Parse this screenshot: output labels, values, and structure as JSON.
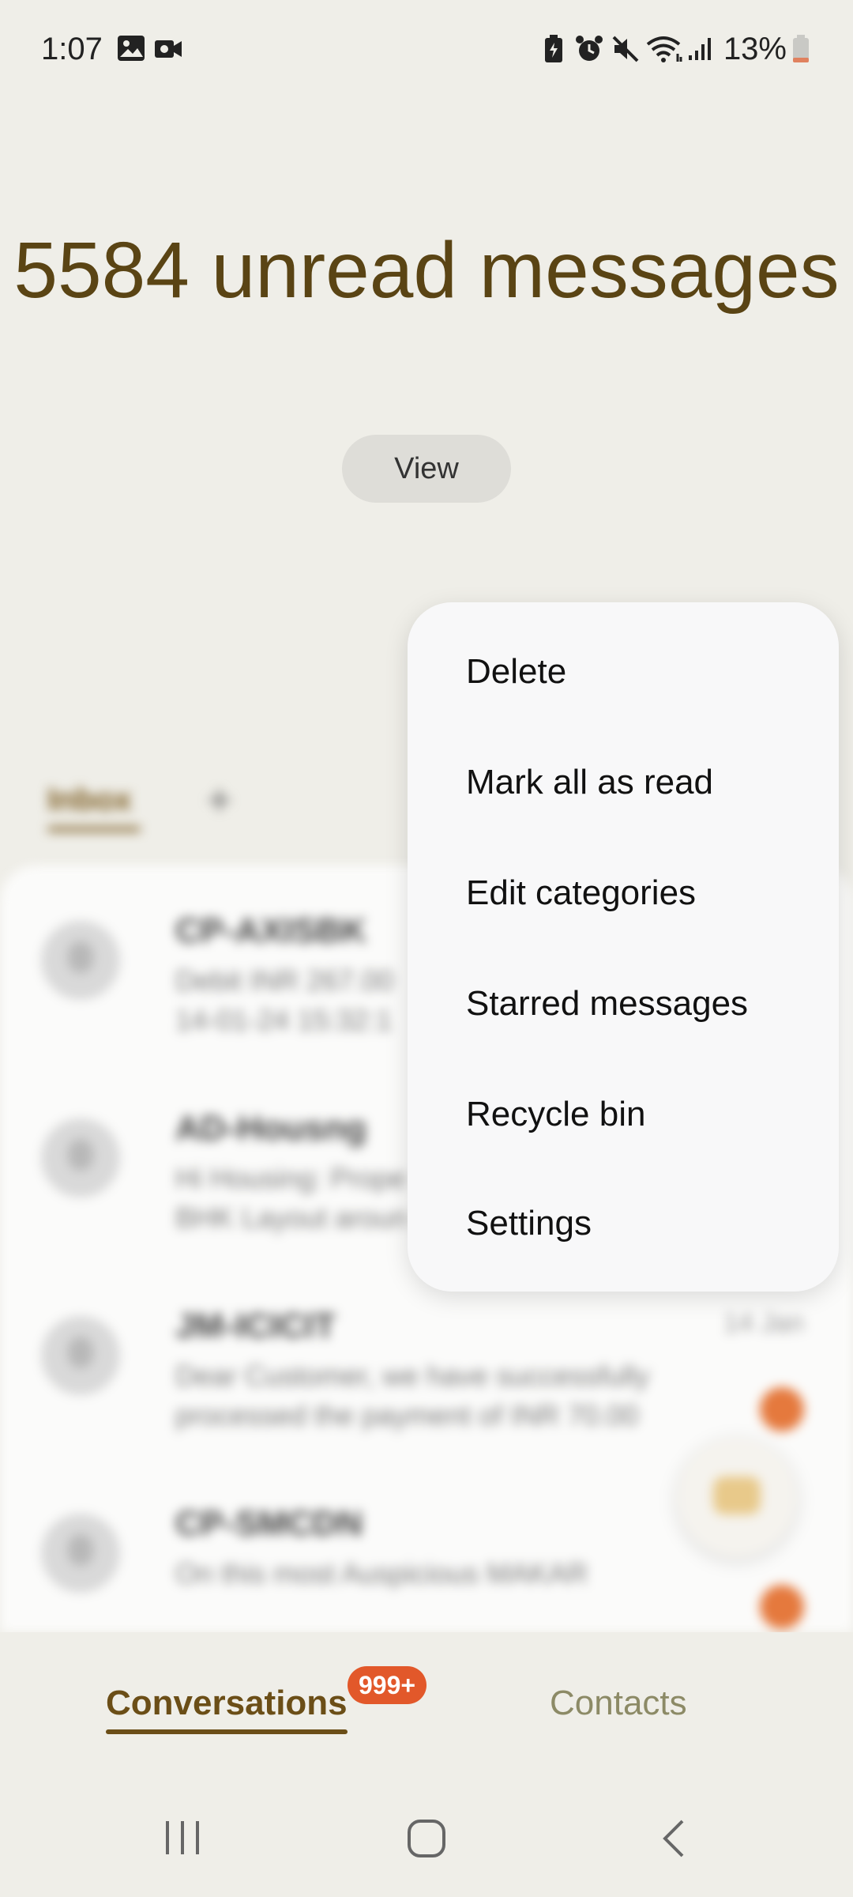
{
  "status_bar": {
    "time": "1:07",
    "battery": "13%",
    "icons": [
      "gallery-icon",
      "video-recording-icon",
      "battery-saver-icon",
      "alarm-icon",
      "mute-icon",
      "wifi-icon",
      "signal-icon",
      "battery-icon"
    ]
  },
  "header": {
    "unread_title": "5584 unread messages",
    "view_button": "View"
  },
  "categories": {
    "tabs": [
      {
        "label": "Inbox",
        "selected": true
      }
    ],
    "add_icon": "plus-icon"
  },
  "conversations": [
    {
      "sender": "CP-AXISBK",
      "preview_line1": "Debit INR 267.00",
      "preview_line2": "14-01-24 15:32:1",
      "date": "",
      "unread": false
    },
    {
      "sender": "AD-Housng",
      "preview_line1": "Hi Housing: Prope",
      "preview_line2": "BHK Layout aroun",
      "date": "",
      "unread": true
    },
    {
      "sender": "JM-ICICIT",
      "preview_line1": "Dear Customer, we have successfully",
      "preview_line2": "processed the payment of INR 70.00",
      "date": "14 Jan",
      "unread": true
    },
    {
      "sender": "CP-SMCDN",
      "preview_line1": "On this most Auspicious MAKAR",
      "preview_line2": "",
      "date": "",
      "unread": true
    }
  ],
  "popup_menu": {
    "items": [
      "Delete",
      "Mark all as read",
      "Edit categories",
      "Starred messages",
      "Recycle bin",
      "Settings"
    ]
  },
  "bottom_nav": {
    "conversations_label": "Conversations",
    "badge": "999+",
    "contacts_label": "Contacts"
  },
  "system_nav": {
    "buttons": [
      "recents-icon",
      "home-icon",
      "back-icon"
    ]
  },
  "colors": {
    "background": "#efeee8",
    "accent_brown": "#5a4414",
    "badge_orange": "#e2582a",
    "menu_background": "#f8f8f9"
  }
}
